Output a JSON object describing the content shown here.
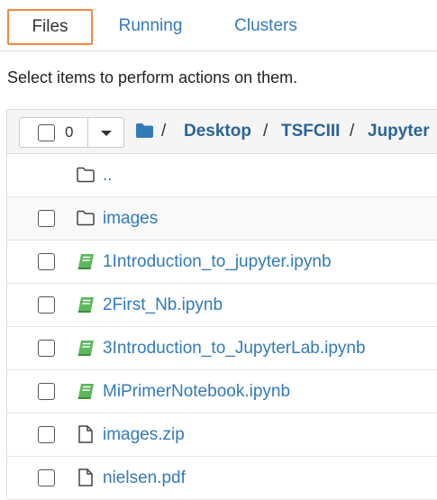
{
  "tabs": [
    {
      "label": "Files",
      "active": true
    },
    {
      "label": "Running",
      "active": false
    },
    {
      "label": "Clusters",
      "active": false
    }
  ],
  "instructions": "Select items to perform actions on them.",
  "selection": {
    "count": "0"
  },
  "breadcrumb": {
    "separator": "/",
    "items": [
      "Desktop",
      "TSFCIII",
      "Jupyter"
    ]
  },
  "rows": [
    {
      "name": "..",
      "type": "parent-folder",
      "checkbox": false
    },
    {
      "name": "images",
      "type": "folder",
      "checkbox": true
    },
    {
      "name": "1Introduction_to_jupyter.ipynb",
      "type": "notebook",
      "checkbox": true
    },
    {
      "name": "2First_Nb.ipynb",
      "type": "notebook",
      "checkbox": true
    },
    {
      "name": "3Introduction_to_JupyterLab.ipynb",
      "type": "notebook",
      "checkbox": true
    },
    {
      "name": "MiPrimerNotebook.ipynb",
      "type": "notebook",
      "checkbox": true
    },
    {
      "name": "images.zip",
      "type": "file",
      "checkbox": true
    },
    {
      "name": "nielsen.pdf",
      "type": "file",
      "checkbox": true
    }
  ],
  "colors": {
    "link": "#337ab7",
    "notebook_icon": "#5cb85c",
    "active_tab_border": "#f0883e"
  }
}
